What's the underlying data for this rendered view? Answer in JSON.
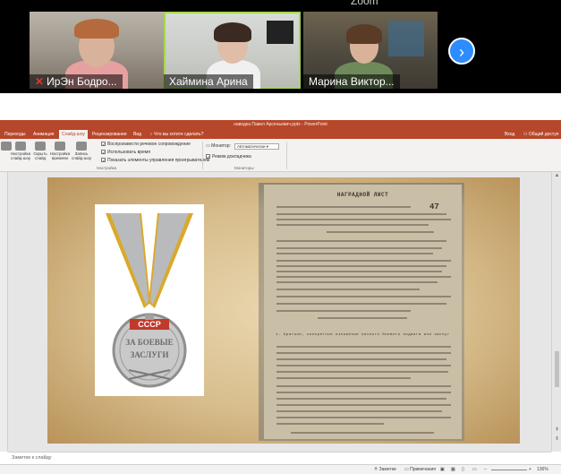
{
  "zoom": {
    "window_title": "Zoom",
    "participants": [
      {
        "name": "ИрЭн Бодро...",
        "muted": true
      },
      {
        "name": "Хаймина Арина",
        "muted": false,
        "active": true
      },
      {
        "name": "Марина Виктор...",
        "muted": false
      }
    ],
    "next_page_icon": "chevron-right-icon"
  },
  "powerpoint": {
    "title": "наводка Павел Арсеньевич.pptx - PowerPoint",
    "tabs": [
      "Переходы",
      "Анимация",
      "Слайд-шоу",
      "Рецензирование",
      "Вид"
    ],
    "active_tab": "Слайд-шоу",
    "tell_me": "Что вы хотите сделать?",
    "signin": "Вход",
    "share": "Общий доступ",
    "ribbon": {
      "buttons": [
        {
          "label": "Настройка слайд-шоу"
        },
        {
          "label": "Скрыть слайд"
        },
        {
          "label": "Настройка времени"
        },
        {
          "label": "Запись слайд-шоу"
        }
      ],
      "checkboxes": [
        {
          "label": "Воспроизвести речевое сопровождение",
          "checked": true
        },
        {
          "label": "Использовать время",
          "checked": true
        },
        {
          "label": "Показать элементы управления проигрывателем",
          "checked": true
        }
      ],
      "group_setup": "Настройка",
      "monitor_label": "Монитор:",
      "monitor_value": "Автоматически",
      "presenter_label": "Режим докладчика",
      "group_monitors": "Мониторы"
    },
    "slide": {
      "doc_title": "НАГРАДНОЙ ЛИСТ",
      "doc_section": "1. Краткое, конкретное изложение личного боевого подвига или заслуг",
      "medal_text_1": "СССР",
      "medal_text_2": "ЗА БОЕВЫЕ",
      "medal_text_3": "ЗАСЛУГИ",
      "doc_number": "47"
    },
    "notes_placeholder": "Заметки к слайду",
    "status": {
      "notes": "Заметки",
      "comments": "Примечания",
      "zoom": "136%"
    }
  }
}
